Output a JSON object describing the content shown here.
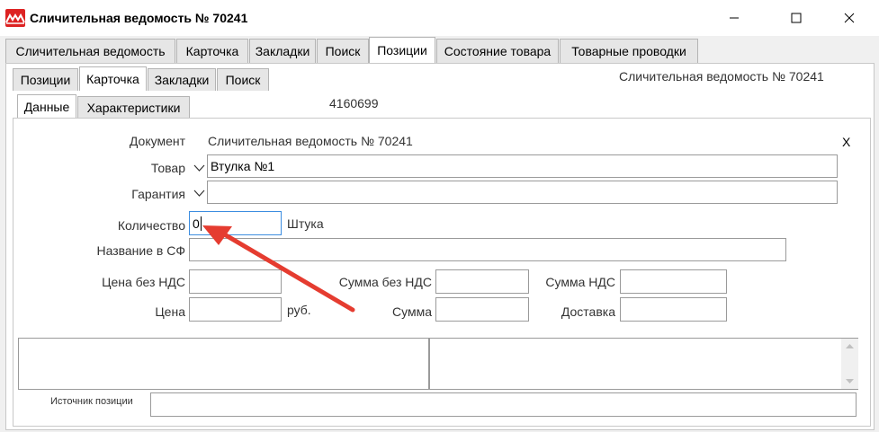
{
  "window": {
    "title": "Сличительная ведомость № 70241",
    "controls": [
      "minimize",
      "maximize",
      "close"
    ]
  },
  "outer_tabs": [
    {
      "label": "Сличительная ведомость",
      "active": false
    },
    {
      "label": "Карточка",
      "active": false
    },
    {
      "label": "Закладки",
      "active": false
    },
    {
      "label": "Поиск",
      "active": false
    },
    {
      "label": "Позиции",
      "active": true
    },
    {
      "label": "Состояние товара",
      "active": false
    },
    {
      "label": "Товарные проводки",
      "active": false
    }
  ],
  "inner_tabs": [
    {
      "label": "Позиции",
      "active": false
    },
    {
      "label": "Карточка",
      "active": true
    },
    {
      "label": "Закладки",
      "active": false
    },
    {
      "label": "Поиск",
      "active": false
    }
  ],
  "sub_tabs": [
    {
      "label": "Данные",
      "active": true
    },
    {
      "label": "Характеристики",
      "active": false
    }
  ],
  "header_title": "Сличительная ведомость № 70241",
  "record_id": "4160699",
  "form": {
    "document_label": "Документ",
    "document_value": "Сличительная ведомость № 70241",
    "close_x": "X",
    "product_label": "Товар",
    "product_value": "Втулка №1",
    "warranty_label": "Гарантия",
    "warranty_value": "",
    "quantity_label": "Количество",
    "quantity_value": "0",
    "unit": "Штука",
    "invoice_name_label": "Название в СФ",
    "invoice_name_value": "",
    "price_no_vat_label": "Цена без НДС",
    "sum_no_vat_label": "Сумма без НДС",
    "vat_sum_label": "Сумма НДС",
    "price_label": "Цена",
    "currency": "руб.",
    "sum_label": "Сумма",
    "delivery_label": "Доставка",
    "source_label": "Источник позиции"
  },
  "colors": {
    "annotation_arrow": "#e53c30",
    "focus_border": "#3c8de0",
    "logo": "#dd2222"
  }
}
